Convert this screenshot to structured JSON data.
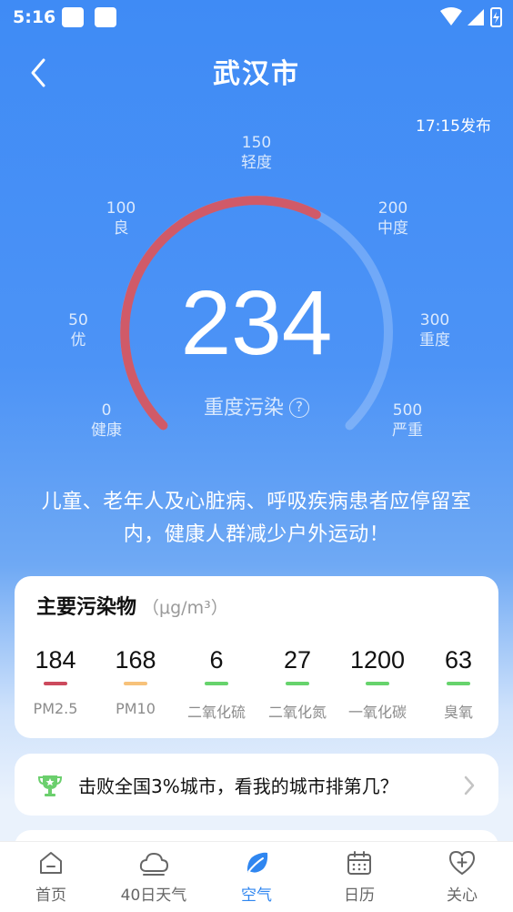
{
  "status_bar": {
    "time": "5:16"
  },
  "header": {
    "title": "武汉市"
  },
  "publish_time": "17:15发布",
  "aqi": {
    "value": "234",
    "level": "重度污染",
    "fraction": 0.6,
    "arc_color": "#d05a68",
    "scale": [
      {
        "value": "0",
        "label": "健康"
      },
      {
        "value": "50",
        "label": "优"
      },
      {
        "value": "100",
        "label": "良"
      },
      {
        "value": "150",
        "label": "轻度"
      },
      {
        "value": "200",
        "label": "中度"
      },
      {
        "value": "300",
        "label": "重度"
      },
      {
        "value": "500",
        "label": "严重"
      }
    ]
  },
  "advice": "儿童、老年人及心脏病、呼吸疾病患者应停留室内，健康人群减少户外运动！",
  "pollutants": {
    "title": "主要污染物",
    "unit": "（μg/m³）",
    "items": [
      {
        "value": "184",
        "name": "PM2.5",
        "color": "#cc4a5d"
      },
      {
        "value": "168",
        "name": "PM10",
        "color": "#f7c27a"
      },
      {
        "value": "6",
        "name": "二氧化硫",
        "color": "#66d36c"
      },
      {
        "value": "27",
        "name": "二氧化氮",
        "color": "#66d36c"
      },
      {
        "value": "1200",
        "name": "一氧化碳",
        "color": "#66d36c"
      },
      {
        "value": "63",
        "name": "臭氧",
        "color": "#66d36c"
      }
    ]
  },
  "ranking": {
    "text": "击败全国3%城市，看我的城市排第几？"
  },
  "tabs": [
    {
      "label": "首页",
      "icon": "home-icon"
    },
    {
      "label": "40日天气",
      "icon": "cloud-icon"
    },
    {
      "label": "空气",
      "icon": "leaf-icon",
      "active": true
    },
    {
      "label": "日历",
      "icon": "calendar-icon"
    },
    {
      "label": "关心",
      "icon": "heart-plus-icon"
    }
  ]
}
